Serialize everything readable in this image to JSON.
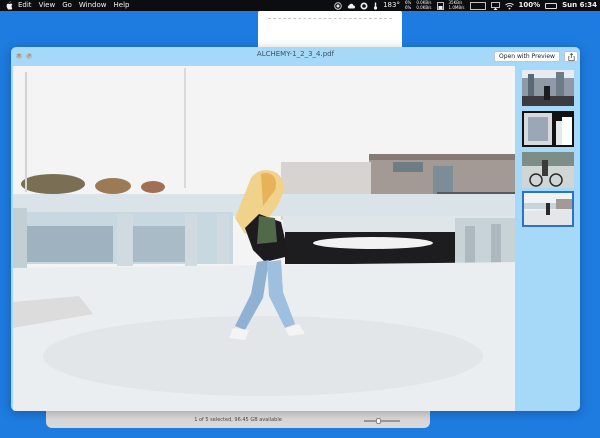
{
  "menubar": {
    "menus": [
      "Edit",
      "View",
      "Go",
      "Window",
      "Help"
    ],
    "temperature": "183°",
    "cpu_top": "6%",
    "cpu_bottom": "6%",
    "net_up": "0.0KB/s",
    "net_down": "0.0KB/s",
    "net2_up": "35KB/s",
    "net2_down": "1.0MB/s",
    "battery_percent": "100%",
    "clock": "Sun 6:34"
  },
  "finder": {
    "status_text": "1 of 5 selected, 96.45 GB available"
  },
  "quicklook": {
    "title": "ALCHEMY-1_2_3_4.pdf",
    "open_button_label": "Open with Preview",
    "selected_page": 4,
    "page_count": 4
  },
  "icons": {
    "apple": "apple-icon",
    "close": "close-icon",
    "fullscreen": "fullscreen-icon",
    "share": "share-icon",
    "wifi": "wifi-icon",
    "battery": "battery-icon"
  },
  "colors": {
    "desktop": "#1e7bdf",
    "window_tint": "#a6d9f8",
    "selection": "#2b73c9"
  }
}
